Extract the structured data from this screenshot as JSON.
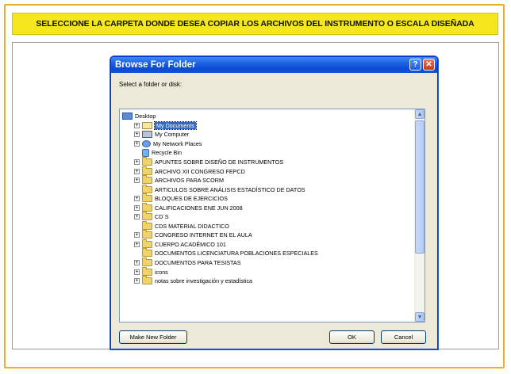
{
  "banner": {
    "text": "SELECCIONE LA CARPETA DONDE DESEA COPIAR LOS ARCHIVOS DEL INSTRUMENTO O ESCALA DISEÑADA"
  },
  "dialog": {
    "title": "Browse For Folder",
    "prompt": "Select a folder or disk:",
    "help_label": "?",
    "close_label": "✕",
    "buttons": {
      "make_new_folder": "Make New Folder",
      "ok": "OK",
      "cancel": "Cancel"
    }
  },
  "tree": {
    "root": {
      "label": "Desktop",
      "icon": "desktop-icon"
    },
    "items": [
      {
        "label": "My Documents",
        "icon": "my-documents-icon",
        "expandable": true,
        "selected": true
      },
      {
        "label": "My Computer",
        "icon": "my-computer-icon",
        "expandable": true
      },
      {
        "label": "My Network Places",
        "icon": "network-places-icon",
        "expandable": true
      },
      {
        "label": "Recycle Bin",
        "icon": "recycle-bin-icon",
        "expandable": false
      },
      {
        "label": "APUNTES SOBRE DISEÑO DE INSTRUMENTOS",
        "icon": "folder-icon",
        "expandable": true
      },
      {
        "label": "ARCHIVO XII CONGRESO FEPCD",
        "icon": "folder-icon",
        "expandable": true
      },
      {
        "label": "ARCHIVOS PARA SCORM",
        "icon": "folder-icon",
        "expandable": true
      },
      {
        "label": "ARTICULOS SOBRE ANÁLISIS ESTADÍSTICO DE DATOS",
        "icon": "folder-icon",
        "expandable": false
      },
      {
        "label": "BLOQUES DE EJERCICIOS",
        "icon": "folder-icon",
        "expandable": true
      },
      {
        "label": "CALIFICACIONES ENE JUN 2008",
        "icon": "folder-icon",
        "expandable": true
      },
      {
        "label": "CD`S",
        "icon": "folder-icon",
        "expandable": true
      },
      {
        "label": "CDS MATERIAL DIDACTICO",
        "icon": "folder-icon",
        "expandable": false
      },
      {
        "label": "CONGRESO INTERNET EN EL AULA",
        "icon": "folder-icon",
        "expandable": true
      },
      {
        "label": "CUERPO ACADÉMICO 101",
        "icon": "folder-icon",
        "expandable": true
      },
      {
        "label": "DOCUMENTOS LICENCIATURA POBLACIONES ESPECIALES",
        "icon": "folder-icon",
        "expandable": false
      },
      {
        "label": "DOCUMENTOS PARA TESISTAS",
        "icon": "folder-icon",
        "expandable": true
      },
      {
        "label": "icons",
        "icon": "folder-icon",
        "expandable": true
      },
      {
        "label": "notas sobre investigación y estadística",
        "icon": "folder-icon",
        "expandable": true
      }
    ]
  },
  "colors": {
    "banner_bg": "#f6e61e",
    "frame_border": "#e7b320",
    "titlebar": "#0a4ad0",
    "selection": "#316ac5"
  }
}
